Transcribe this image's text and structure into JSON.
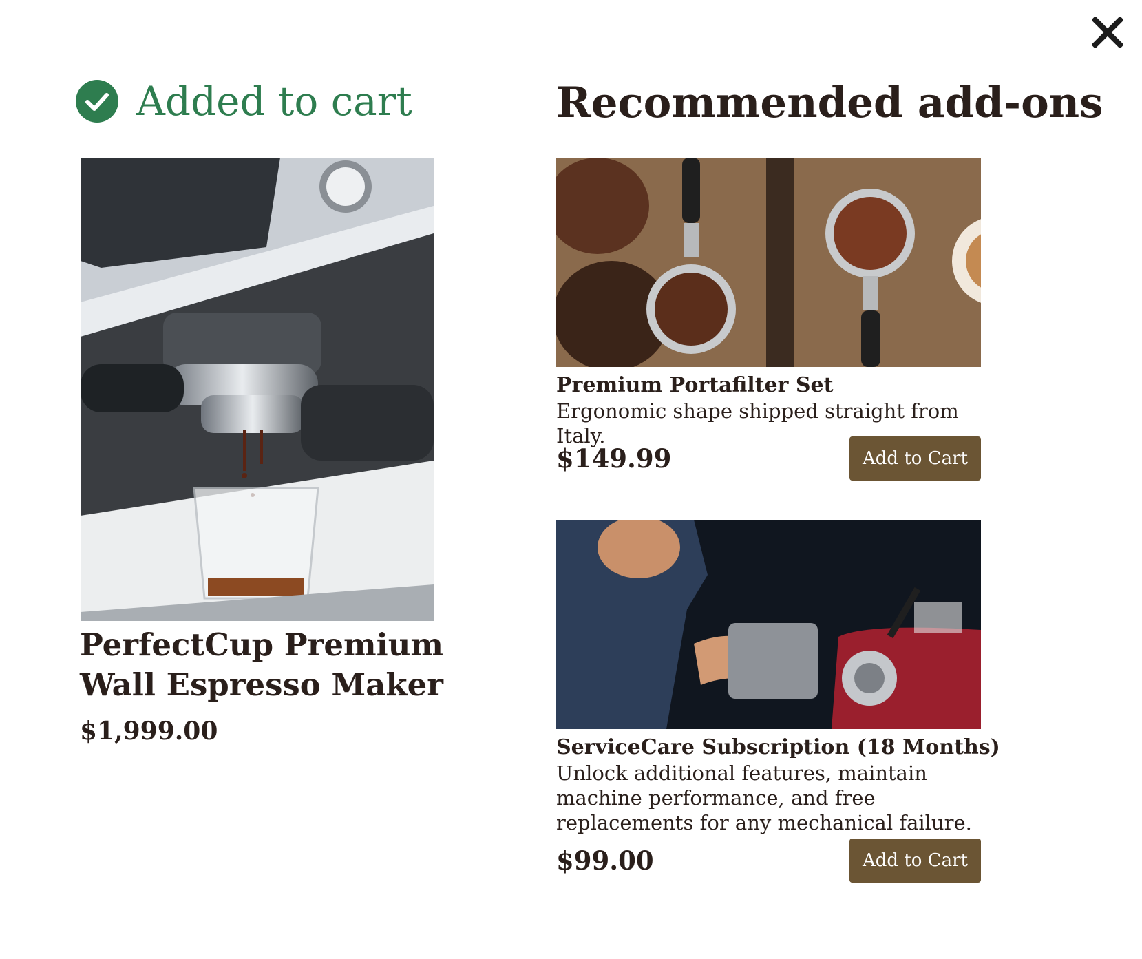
{
  "colors": {
    "success": "#2e7d4f",
    "button_bg": "#6b5534",
    "text": "#2a1f1b"
  },
  "close": {
    "icon": "close-icon"
  },
  "added": {
    "icon": "check-circle-icon",
    "label": "Added to cart"
  },
  "product": {
    "image_alt": "Espresso machine pouring a shot into a glass",
    "title": "PerfectCup Premium Wall Espresso Maker",
    "price": "$1,999.00"
  },
  "recommendations": {
    "title": "Recommended add-ons",
    "items": [
      {
        "image_alt": "Two portafilters with ground coffee and beans on a wooden board",
        "name": "Premium Portafilter Set",
        "description": "Ergonomic shape shipped straight from Italy.",
        "price": "$149.99",
        "button_label": "Add to Cart"
      },
      {
        "image_alt": "Barista using a red espresso machine",
        "name": "ServiceCare Subscription (18 Months)",
        "description": "Unlock additional features, maintain machine performance, and free replacements for any mechanical failure.",
        "price": "$99.00",
        "button_label": "Add to Cart"
      }
    ]
  }
}
